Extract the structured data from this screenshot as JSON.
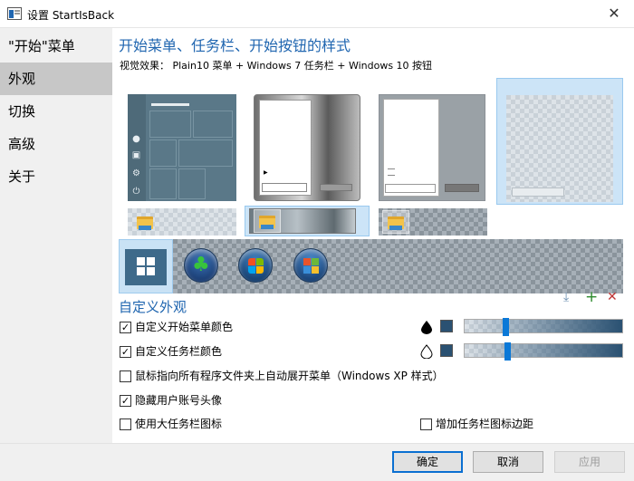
{
  "window": {
    "title": "设置 StartIsBack",
    "close_glyph": "✕"
  },
  "sidebar": {
    "items": [
      {
        "label": "\"开始\"菜单"
      },
      {
        "label": "外观"
      },
      {
        "label": "切换"
      },
      {
        "label": "高级"
      },
      {
        "label": "关于"
      }
    ],
    "selected": "外观"
  },
  "main": {
    "section_title": "开始菜单、任务栏、开始按钮的样式",
    "visual_effect": "视觉效果： Plain10 菜单 + Windows 7 任务栏 + Windows 10 按钮",
    "custom_title": "自定义外观",
    "options": [
      {
        "label": "自定义开始菜单颜色",
        "checked": true,
        "check_glyph": "✓"
      },
      {
        "label": "自定义任务栏颜色",
        "checked": true,
        "check_glyph": "✓"
      },
      {
        "label": "鼠标指向所有程序文件夹上自动展开菜单（Windows XP 样式）",
        "checked": false,
        "check_glyph": ""
      },
      {
        "label": "隐藏用户账号头像",
        "checked": true,
        "check_glyph": "✓"
      },
      {
        "label": "使用大任务栏图标",
        "checked": false,
        "check_glyph": ""
      }
    ],
    "extra_option": {
      "label": "增加任务栏图标边距",
      "checked": false
    },
    "color_sliders": [
      {
        "target": "start_menu",
        "swatch_color": "#2a5172",
        "level_percent": 25
      },
      {
        "target": "taskbar",
        "swatch_color": "#2a5172",
        "level_percent": 25
      }
    ],
    "menu_styles_selected": "Windows 10",
    "taskbar_styles_selected": "Windows 7",
    "orb_selected": "Windows 10",
    "icons": [
      "download-icon",
      "add-icon",
      "delete-icon"
    ]
  },
  "footer": {
    "ok": "确定",
    "cancel": "取消",
    "apply": "应用"
  },
  "colors": {
    "accent": "#2066b0",
    "selection": "#cce4f7",
    "slider_thumb": "#0a78d7"
  }
}
